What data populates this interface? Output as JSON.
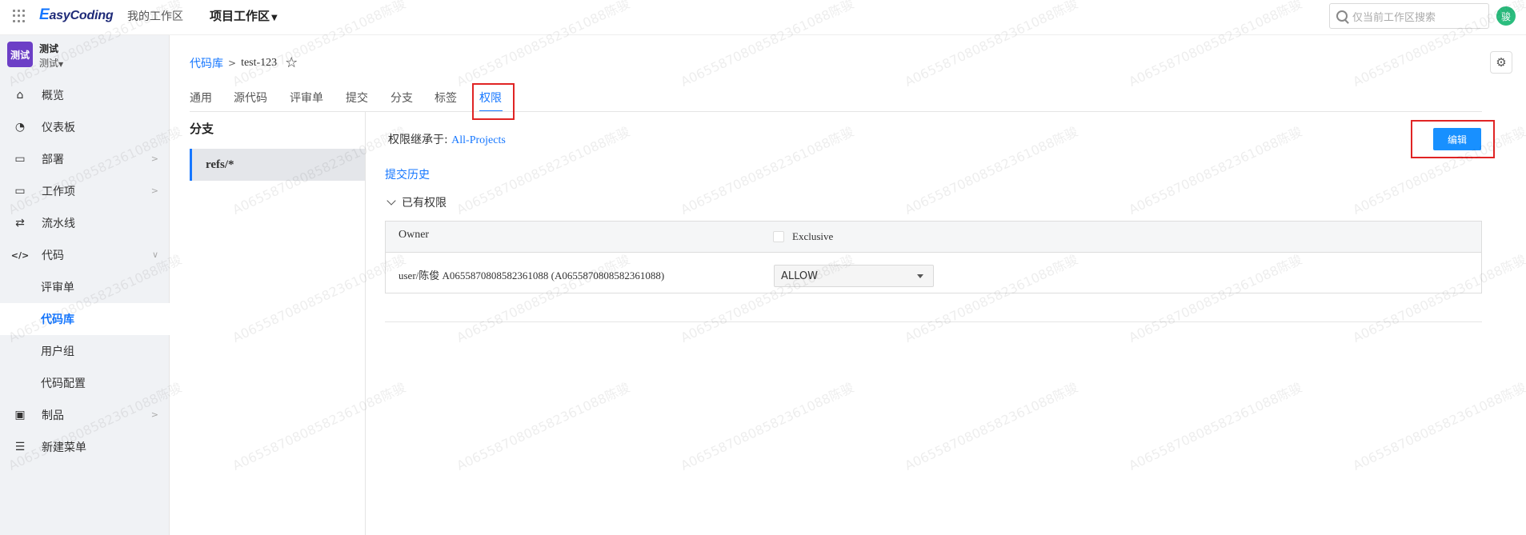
{
  "topbar": {
    "logo_e": "E",
    "logo_rest": "asyCoding",
    "nav_my": "我的工作区",
    "nav_project": "项目工作区",
    "search_placeholder": "仅当前工作区搜索",
    "user_avatar": "骏"
  },
  "project": {
    "avatar": "测试",
    "name": "测试",
    "sub": "测试"
  },
  "sidebar": {
    "items": [
      {
        "label": "概览",
        "icon": "home-icon",
        "glyph": "⌂"
      },
      {
        "label": "仪表板",
        "icon": "dashboard-icon",
        "glyph": "◔"
      },
      {
        "label": "部署",
        "icon": "deploy-icon",
        "glyph": "▭"
      },
      {
        "label": "工作项",
        "icon": "workitem-icon",
        "glyph": "▭"
      },
      {
        "label": "流水线",
        "icon": "pipeline-icon",
        "glyph": "⇄"
      },
      {
        "label": "代码",
        "icon": "code-icon",
        "glyph": "</>"
      },
      {
        "label": "评审单"
      },
      {
        "label": "代码库"
      },
      {
        "label": "用户组"
      },
      {
        "label": "代码配置"
      },
      {
        "label": "制品",
        "icon": "artifact-icon",
        "glyph": "▣"
      },
      {
        "label": "新建菜单",
        "icon": "list-icon",
        "glyph": "☰"
      }
    ]
  },
  "breadcrumb": {
    "root": "代码库",
    "current": "test-123"
  },
  "tabs": [
    "通用",
    "源代码",
    "评审单",
    "提交",
    "分支",
    "标签",
    "权限"
  ],
  "branch": {
    "title": "分支",
    "item": "refs/*"
  },
  "permission": {
    "inherit_label": "权限继承于: ",
    "inherit_link": "All-Projects",
    "history": "提交历史",
    "existing": "已有权限",
    "edit": "编辑",
    "table": {
      "col_owner": "Owner",
      "col_exclusive": "Exclusive",
      "row_user": "user/陈俊 A0655870808582361088 (A0655870808582361088)",
      "row_value": "ALLOW"
    }
  },
  "watermark": "A0655870808582361088陈骏"
}
